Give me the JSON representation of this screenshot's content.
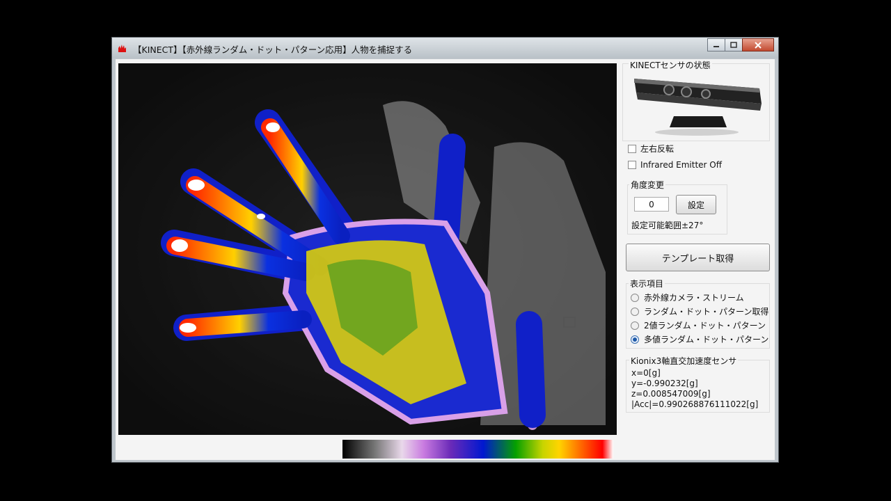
{
  "window": {
    "title": "【KINECT】【赤外線ランダム・ドット・パターン応用】人物を捕捉する"
  },
  "panel": {
    "sensor_group_label": "KINECTセンサの状態",
    "flip_label": "左右反転",
    "flip_checked": false,
    "emitter_label": "Infrared Emitter Off",
    "emitter_checked": false,
    "angle_group_label": "角度変更",
    "angle_value": "0",
    "angle_set_button": "設定",
    "angle_range_text": "設定可能範囲±27°",
    "template_button": "テンプレート取得",
    "display_group_label": "表示項目",
    "display_options": [
      {
        "label": "赤外線カメラ・ストリーム",
        "selected": false
      },
      {
        "label": "ランダム・ドット・パターン取得",
        "selected": false
      },
      {
        "label": "2値ランダム・ドット・パターン",
        "selected": false
      },
      {
        "label": "多値ランダム・ドット・パターン",
        "selected": true
      }
    ],
    "accel_group_label": "Kionix3軸直交加速度センサ",
    "accel_lines": [
      "x=0[g]",
      "y=-0.990232[g]",
      "z=0.008547009[g]",
      "|Acc|=0.990268876111022[g]"
    ]
  },
  "colors": {
    "accent_selected": "#1f5aa8",
    "close_button": "#c24a30"
  },
  "icons": [
    "app-icon",
    "minimize-icon",
    "maximize-icon",
    "close-icon",
    "kinect-sensor-image"
  ]
}
